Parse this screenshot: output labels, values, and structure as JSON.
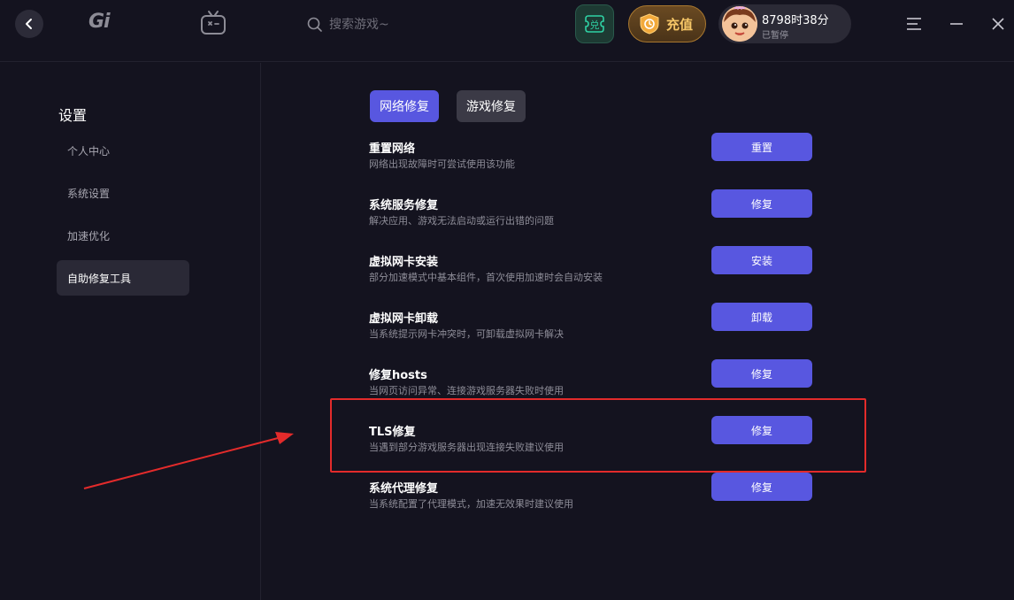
{
  "header": {
    "logo_text": "Gi",
    "search_placeholder": "搜索游戏~",
    "redeem_label": "兑",
    "recharge_label": "充值",
    "user": {
      "time_remaining": "8798时38分",
      "status": "已暂停"
    }
  },
  "sidebar": {
    "title": "设置",
    "items": [
      {
        "label": "个人中心",
        "active": false
      },
      {
        "label": "系统设置",
        "active": false
      },
      {
        "label": "加速优化",
        "active": false
      },
      {
        "label": "自助修复工具",
        "active": true
      }
    ]
  },
  "main": {
    "tabs": [
      {
        "label": "网络修复",
        "active": true
      },
      {
        "label": "游戏修复",
        "active": false
      }
    ],
    "rows": [
      {
        "title": "重置网络",
        "desc": "网络出现故障时可尝试使用该功能",
        "button": "重置"
      },
      {
        "title": "系统服务修复",
        "desc": "解决应用、游戏无法启动或运行出错的问题",
        "button": "修复"
      },
      {
        "title": "虚拟网卡安装",
        "desc": "部分加速模式中基本组件，首次使用加速时会自动安装",
        "button": "安装"
      },
      {
        "title": "虚拟网卡卸载",
        "desc": "当系统提示网卡冲突时，可卸载虚拟网卡解决",
        "button": "卸载"
      },
      {
        "title": "修复hosts",
        "desc": "当网页访问异常、连接游戏服务器失败时使用",
        "button": "修复"
      },
      {
        "title": "TLS修复",
        "desc": "当遇到部分游戏服务器出现连接失败建议使用",
        "button": "修复"
      },
      {
        "title": "系统代理修复",
        "desc": "当系统配置了代理模式，加速无效果时建议使用",
        "button": "修复"
      }
    ]
  },
  "colors": {
    "background": "#14131f",
    "accent": "#5857e0",
    "highlight": "#e32b2b",
    "recharge_gold": "#f7c767"
  }
}
